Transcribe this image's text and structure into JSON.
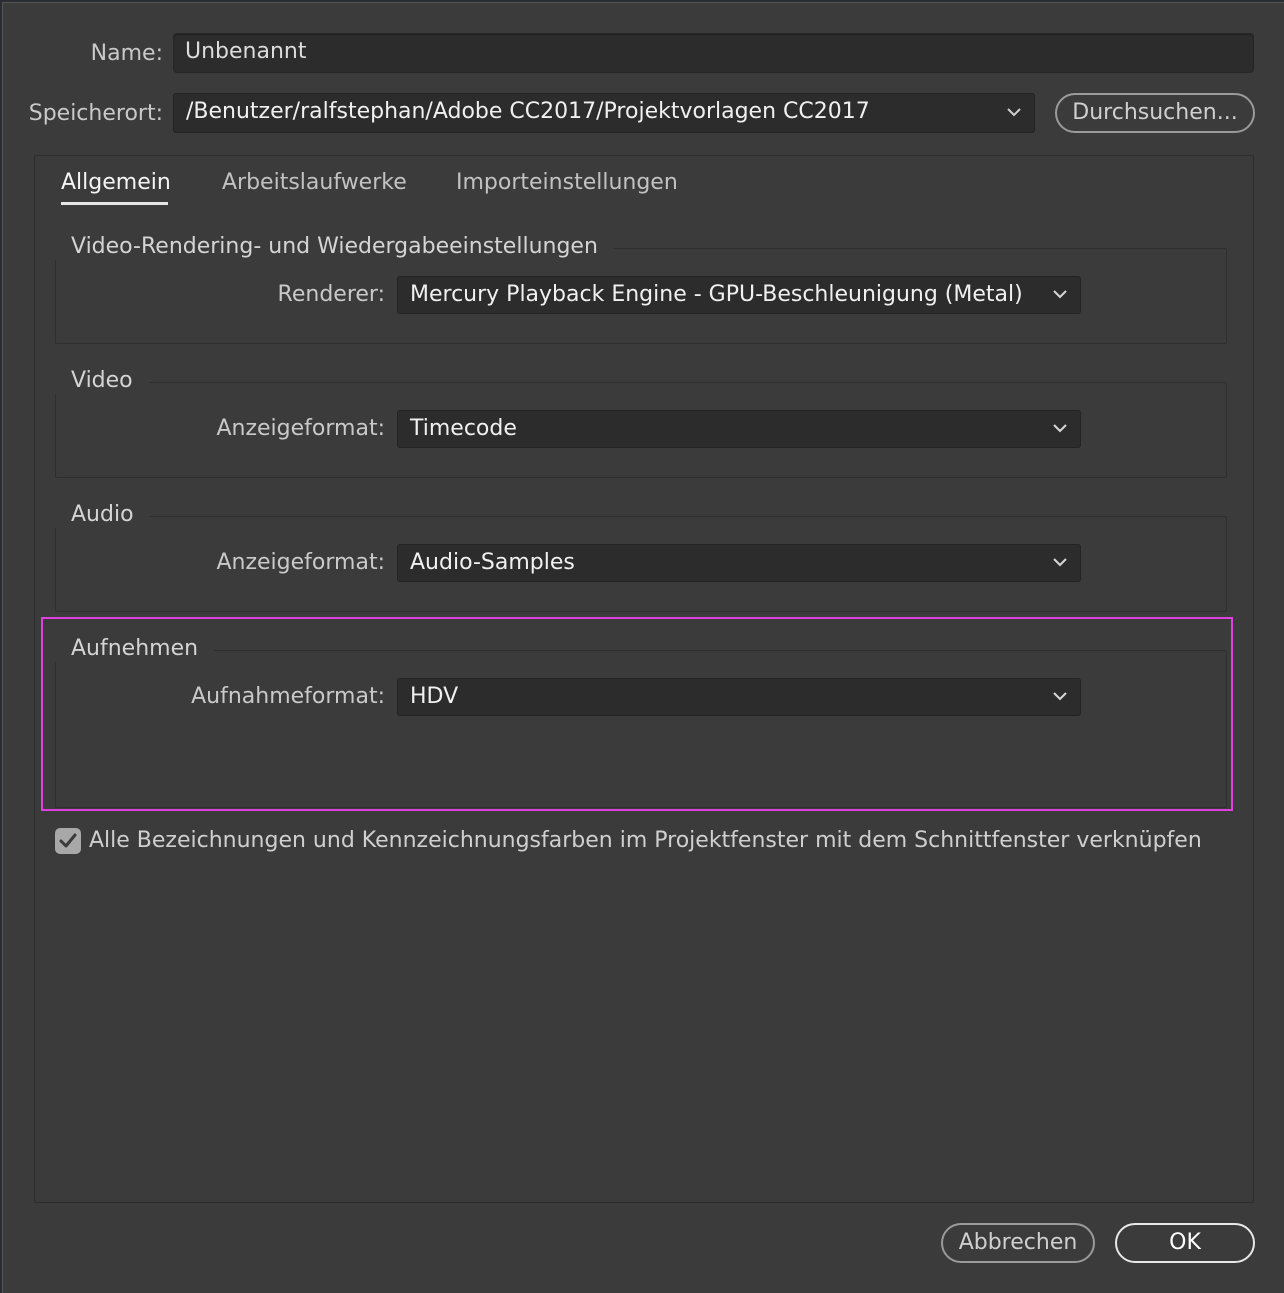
{
  "name_row": {
    "label": "Name:",
    "value": "Unbenannt"
  },
  "location_row": {
    "label": "Speicherort:",
    "value": "/Benutzer/ralfstephan/Adobe CC2017/Projektvorlagen CC2017",
    "browse_label": "Durchsuchen..."
  },
  "tabs": [
    {
      "label": "Allgemein",
      "active": true
    },
    {
      "label": "Arbeitslaufwerke",
      "active": false
    },
    {
      "label": "Importeinstellungen",
      "active": false
    }
  ],
  "groups": {
    "rendering": {
      "title": "Video-Rendering- und Wiedergabeeinstellungen",
      "field_label": "Renderer:",
      "field_value": "Mercury Playback Engine - GPU-Beschleunigung (Metal)"
    },
    "video": {
      "title": "Video",
      "field_label": "Anzeigeformat:",
      "field_value": "Timecode"
    },
    "audio": {
      "title": "Audio",
      "field_label": "Anzeigeformat:",
      "field_value": "Audio-Samples"
    },
    "capture": {
      "title": "Aufnehmen",
      "field_label": "Aufnahmeformat:",
      "field_value": "HDV"
    }
  },
  "link_checkbox": {
    "checked": true,
    "label": "Alle Bezeichnungen und Kennzeichnungsfarben im Projektfenster mit dem Schnittfenster verknüpfen"
  },
  "footer": {
    "cancel_label": "Abbrechen",
    "ok_label": "OK"
  },
  "colors": {
    "dialog_bg": "#3b3b3b",
    "highlight": "#e040e0"
  },
  "icons": {
    "dropdown": "chevron-down-icon",
    "checkbox": "checkmark-icon"
  }
}
